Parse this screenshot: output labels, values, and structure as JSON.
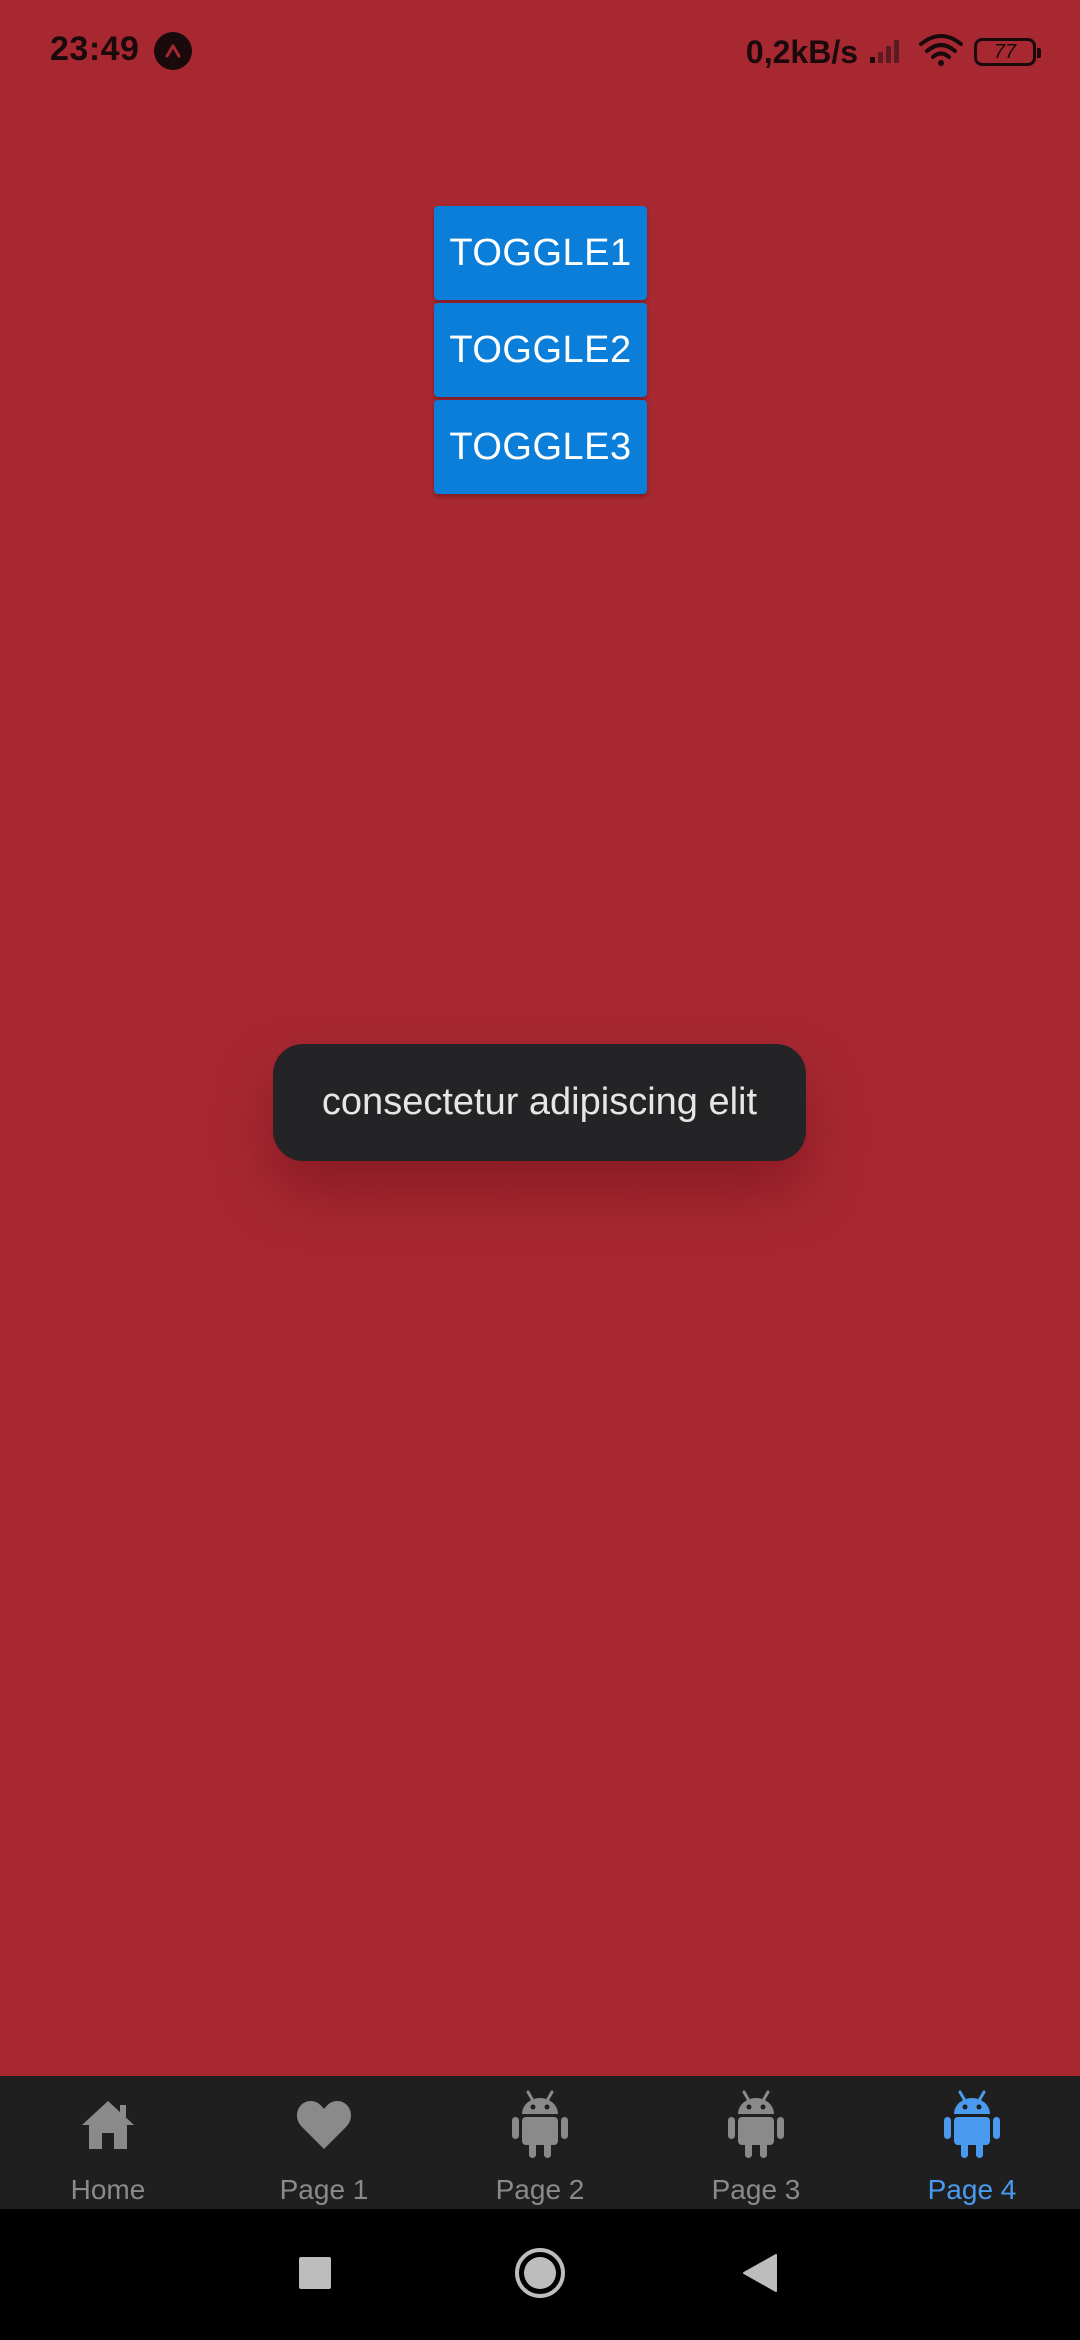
{
  "status_bar": {
    "time": "23:49",
    "net_speed": "0,2kB/s",
    "battery_level": "77"
  },
  "toggles": [
    {
      "label": "TOGGLE1"
    },
    {
      "label": "TOGGLE2"
    },
    {
      "label": "TOGGLE3"
    }
  ],
  "toast": {
    "message": "consectetur adipiscing elit"
  },
  "tab_bar": {
    "tabs": [
      {
        "label": "Home",
        "icon": "home-icon",
        "active": false
      },
      {
        "label": "Page 1",
        "icon": "heart-icon",
        "active": false
      },
      {
        "label": "Page 2",
        "icon": "android-icon",
        "active": false
      },
      {
        "label": "Page 3",
        "icon": "android-icon",
        "active": false
      },
      {
        "label": "Page 4",
        "icon": "android-icon",
        "active": true
      }
    ]
  },
  "nav_bar": {
    "buttons": [
      "recents",
      "home",
      "back"
    ]
  },
  "colors": {
    "background": "#a82832",
    "button": "#0a7ed8",
    "toast": "#242326",
    "tab_bar": "#1f1f1f",
    "tab_active": "#4a9af0",
    "tab_inactive": "#8a8a8a"
  }
}
